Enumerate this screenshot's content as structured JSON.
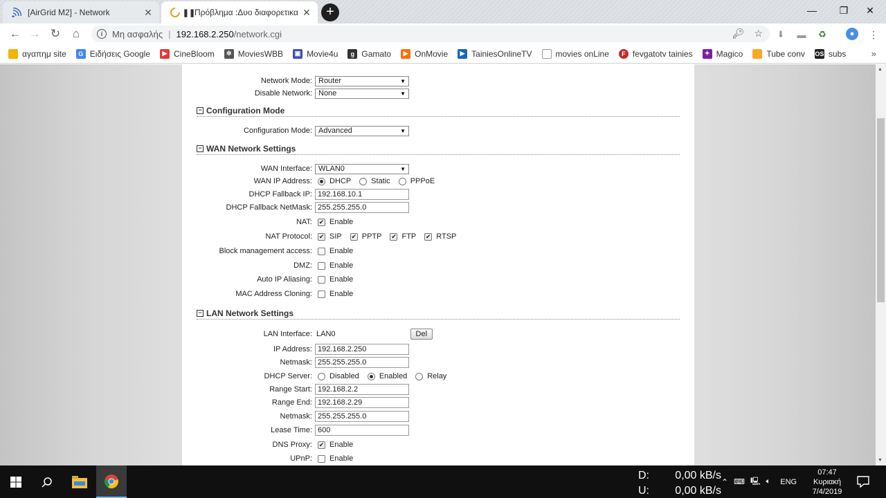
{
  "browser": {
    "tabs": [
      {
        "title": "[AirGrid M2] - Network",
        "icon": "wifi-icon",
        "active": false
      },
      {
        "title": "Πρόβλημα :Δυο διαφορετικα",
        "icon": "loading-spinner-icon",
        "active": true
      }
    ],
    "new_tab_label": "+",
    "address": {
      "security": "Μη ασφαλής",
      "host": "192.168.2.250",
      "path": "/network.cgi"
    },
    "bookmarks": [
      {
        "label": "αγαπημ site",
        "icon": "folder-icon",
        "color": "#f4b400"
      },
      {
        "label": "Ειδήσεις Google",
        "icon": "google-news-icon",
        "color": "#4285f4"
      },
      {
        "label": "CineBloom",
        "icon": "cinebloom-icon",
        "color": "#e53935"
      },
      {
        "label": "MoviesWBB",
        "icon": "movieswbb-icon",
        "color": "#555555"
      },
      {
        "label": "Movie4u",
        "icon": "movie4u-icon",
        "color": "#3f51b5"
      },
      {
        "label": "Gamato",
        "icon": "gamato-icon",
        "color": "#333333"
      },
      {
        "label": "OnMovie",
        "icon": "play-icon",
        "color": "#ff6d00"
      },
      {
        "label": "TainiesOnlineTV",
        "icon": "tainies-icon",
        "color": "#1565c0"
      },
      {
        "label": "movies onLine",
        "icon": "page-icon",
        "color": "#9e9e9e"
      },
      {
        "label": "fevgatotv tainies",
        "icon": "fevgato-icon",
        "color": "#c62828"
      },
      {
        "label": "Magico",
        "icon": "magico-icon",
        "color": "#7b1fa2"
      },
      {
        "label": "Tube conv",
        "icon": "tube-icon",
        "color": "#f9a825"
      },
      {
        "label": "subs",
        "icon": "subs-icon",
        "color": "#212121"
      }
    ]
  },
  "form": {
    "network_mode": {
      "label": "Network Mode:",
      "value": "Router"
    },
    "disable_network": {
      "label": "Disable Network:",
      "value": "None"
    },
    "config_section": {
      "title": "Configuration Mode"
    },
    "config_mode": {
      "label": "Configuration Mode:",
      "value": "Advanced"
    },
    "wan_section": {
      "title": "WAN Network Settings"
    },
    "wan_interface": {
      "label": "WAN Interface:",
      "value": "WLAN0"
    },
    "wan_ip": {
      "label": "WAN IP Address:",
      "options": [
        "DHCP",
        "Static",
        "PPPoE"
      ],
      "selected": "DHCP"
    },
    "dhcp_fallback_ip": {
      "label": "DHCP Fallback IP:",
      "value": "192.168.10.1"
    },
    "dhcp_fallback_netmask": {
      "label": "DHCP Fallback NetMask:",
      "value": "255.255.255.0"
    },
    "nat": {
      "label": "NAT:",
      "option": "Enable",
      "checked": true
    },
    "nat_protocol": {
      "label": "NAT Protocol:",
      "options": [
        "SIP",
        "PPTP",
        "FTP",
        "RTSP"
      ]
    },
    "block_mgmt": {
      "label": "Block management access:",
      "option": "Enable",
      "checked": false
    },
    "dmz": {
      "label": "DMZ:",
      "option": "Enable",
      "checked": false
    },
    "auto_ip_aliasing": {
      "label": "Auto IP Aliasing:",
      "option": "Enable",
      "checked": false
    },
    "mac_cloning": {
      "label": "MAC Address Cloning:",
      "option": "Enable",
      "checked": false
    },
    "lan_section": {
      "title": "LAN Network Settings"
    },
    "lan_interface": {
      "label": "LAN Interface:",
      "value": "LAN0",
      "button": "Del"
    },
    "ip_address": {
      "label": "IP Address:",
      "value": "192.168.2.250"
    },
    "netmask": {
      "label": "Netmask:",
      "value": "255.255.255.0"
    },
    "dhcp_server": {
      "label": "DHCP Server:",
      "options": [
        "Disabled",
        "Enabled",
        "Relay"
      ],
      "selected": "Enabled"
    },
    "range_start": {
      "label": "Range Start:",
      "value": "192.168.2.2"
    },
    "range_end": {
      "label": "Range End:",
      "value": "192.168.2.29"
    },
    "netmask2": {
      "label": "Netmask:",
      "value": "255.255.255.0"
    },
    "lease_time": {
      "label": "Lease Time:",
      "value": "600"
    },
    "dns_proxy": {
      "label": "DNS Proxy:",
      "option": "Enable",
      "checked": true
    },
    "upnp": {
      "label": "UPnP:",
      "option": "Enable",
      "checked": false
    }
  },
  "taskbar": {
    "net_down_label": "D:",
    "net_down": "0,00 kB/s",
    "net_up_label": "U:",
    "net_up": "0,00 kB/s",
    "lang": "ENG",
    "time": "07:47",
    "day": "Κυριακή",
    "date": "7/4/2019"
  }
}
